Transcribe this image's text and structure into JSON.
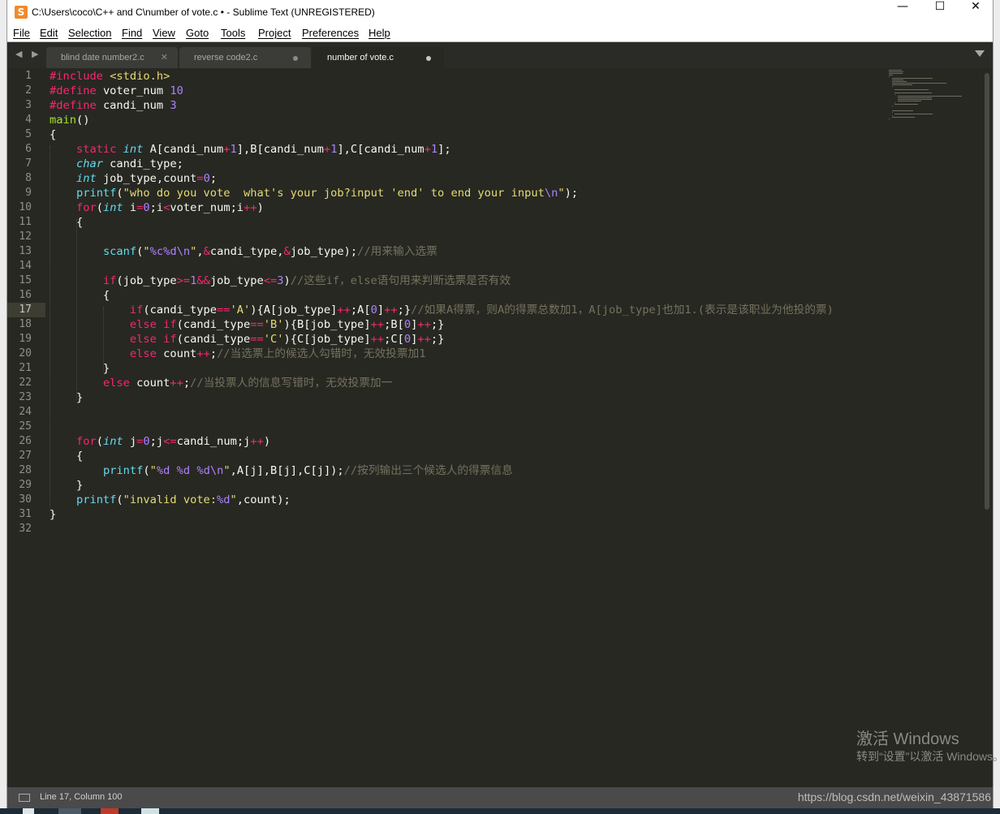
{
  "window": {
    "title": "C:\\Users\\coco\\C++ and C\\number of vote.c • - Sublime Text (UNREGISTERED)",
    "app_icon": "S",
    "minimize": "—",
    "maximize": "☐",
    "close": "✕"
  },
  "menu": [
    "File",
    "Edit",
    "Selection",
    "Find",
    "View",
    "Goto",
    "Tools",
    "Project",
    "Preferences",
    "Help"
  ],
  "tabs": [
    {
      "label": "blind date number2.c",
      "state": "close"
    },
    {
      "label": "reverse code2.c",
      "state": "dirty"
    },
    {
      "label": "number of vote.c",
      "state": "dirty-active"
    }
  ],
  "nav_arrows": "◀ ▶",
  "current_line": 17,
  "status": {
    "position": "Line 17, Column 100",
    "url": "https://blog.csdn.net/weixin_43871586"
  },
  "watermark": {
    "line1": "激活 Windows",
    "line2": "转到“设置”以激活 Windows。"
  },
  "code_lines": [
    "#include <stdio.h>",
    "#define voter_num 10",
    "#define candi_num 3",
    "main()",
    "{",
    "    static int A[candi_num+1],B[candi_num+1],C[candi_num+1];",
    "    char candi_type;",
    "    int job_type,count=0;",
    "    printf(\"who do you vote  what's your job?input 'end' to end your input\\n\");",
    "    for(int i=0;i<voter_num;i++)",
    "    {",
    "",
    "        scanf(\"%c%d\\n\",&candi_type,&job_type);//用来输入选票",
    "",
    "        if(job_type>=1&&job_type<=3)//这些if，else语句用来判断选票是否有效",
    "        {",
    "            if(candi_type=='A'){A[job_type]++;A[0]++;}//如果A得票，则A的得票总数加1，A[job_type]也加1.(表示是该职业为他投的票)",
    "            else if(candi_type=='B'){B[job_type]++;B[0]++;}",
    "            else if(candi_type=='C'){C[job_type]++;C[0]++;}",
    "            else count++;//当选票上的候选人勾错时，无效投票加1",
    "        }",
    "        else count++;//当投票人的信息写错时，无效投票加一",
    "    }",
    "",
    "",
    "    for(int j=0;j<=candi_num;j++)",
    "    {",
    "        printf(\"%d %d %d\\n\",A[j],B[j],C[j]);//按列输出三个候选人的得票信息",
    "    }",
    "    printf(\"invalid vote:%d\",count);",
    "}",
    ""
  ]
}
